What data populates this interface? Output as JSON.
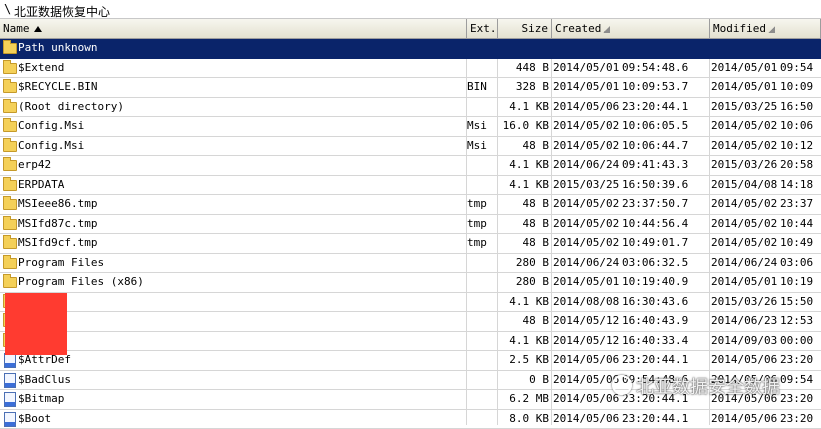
{
  "path_bar": {
    "text": "北亚数据恢复中心"
  },
  "columns": {
    "name": "Name",
    "ext": "Ext.",
    "size": "Size",
    "created": "Created",
    "modified": "Modified"
  },
  "rows": [
    {
      "name": "Path unknown",
      "ext": "",
      "size": "",
      "cdate": "",
      "ctime": "",
      "mdate": "",
      "mtime": "",
      "icon": "folder-icon",
      "selected": true
    },
    {
      "name": "$Extend",
      "ext": "",
      "size": "448 B",
      "cdate": "2014/05/01",
      "ctime": "09:54:48.6",
      "mdate": "2014/05/01",
      "mtime": "09:54",
      "icon": "folder-icon"
    },
    {
      "name": "$RECYCLE.BIN",
      "ext": "BIN",
      "size": "328 B",
      "cdate": "2014/05/01",
      "ctime": "10:09:53.7",
      "mdate": "2014/05/01",
      "mtime": "10:09",
      "icon": "folder-icon"
    },
    {
      "name": "(Root directory)",
      "ext": "",
      "size": "4.1 KB",
      "cdate": "2014/05/06",
      "ctime": "23:20:44.1",
      "mdate": "2015/03/25",
      "mtime": "16:50",
      "icon": "folder-icon"
    },
    {
      "name": "Config.Msi",
      "ext": "Msi",
      "size": "16.0 KB",
      "cdate": "2014/05/02",
      "ctime": "10:06:05.5",
      "mdate": "2014/05/02",
      "mtime": "10:06",
      "icon": "folder-icon"
    },
    {
      "name": "Config.Msi",
      "ext": "Msi",
      "size": "48 B",
      "cdate": "2014/05/02",
      "ctime": "10:06:44.7",
      "mdate": "2014/05/02",
      "mtime": "10:12",
      "icon": "folder-icon"
    },
    {
      "name": "erp42",
      "ext": "",
      "size": "4.1 KB",
      "cdate": "2014/06/24",
      "ctime": "09:41:43.3",
      "mdate": "2015/03/26",
      "mtime": "20:58",
      "icon": "folder-icon"
    },
    {
      "name": "ERPDATA",
      "ext": "",
      "size": "4.1 KB",
      "cdate": "2015/03/25",
      "ctime": "16:50:39.6",
      "mdate": "2015/04/08",
      "mtime": "14:18",
      "icon": "folder-icon"
    },
    {
      "name": "MSIeee86.tmp",
      "ext": "tmp",
      "size": "48 B",
      "cdate": "2014/05/02",
      "ctime": "23:37:50.7",
      "mdate": "2014/05/02",
      "mtime": "23:37",
      "icon": "folder-icon"
    },
    {
      "name": "MSIfd87c.tmp",
      "ext": "tmp",
      "size": "48 B",
      "cdate": "2014/05/02",
      "ctime": "10:44:56.4",
      "mdate": "2014/05/02",
      "mtime": "10:44",
      "icon": "folder-icon"
    },
    {
      "name": "MSIfd9cf.tmp",
      "ext": "tmp",
      "size": "48 B",
      "cdate": "2014/05/02",
      "ctime": "10:49:01.7",
      "mdate": "2014/05/02",
      "mtime": "10:49",
      "icon": "folder-icon"
    },
    {
      "name": "Program Files",
      "ext": "",
      "size": "280 B",
      "cdate": "2014/06/24",
      "ctime": "03:06:32.5",
      "mdate": "2014/06/24",
      "mtime": "03:06",
      "icon": "folder-icon"
    },
    {
      "name": "Program Files (x86)",
      "ext": "",
      "size": "280 B",
      "cdate": "2014/05/01",
      "ctime": "10:19:40.9",
      "mdate": "2014/05/01",
      "mtime": "10:19",
      "icon": "folder-icon"
    },
    {
      "name": "",
      "ext": "",
      "size": "4.1 KB",
      "cdate": "2014/08/08",
      "ctime": "16:30:43.6",
      "mdate": "2015/03/26",
      "mtime": "15:50",
      "icon": "folder-icon"
    },
    {
      "name": "",
      "ext": "",
      "size": "48 B",
      "cdate": "2014/05/12",
      "ctime": "16:40:43.9",
      "mdate": "2014/06/23",
      "mtime": "12:53",
      "icon": "folder-icon"
    },
    {
      "name": "",
      "ext": "",
      "size": "4.1 KB",
      "cdate": "2014/05/12",
      "ctime": "16:40:33.4",
      "mdate": "2014/09/03",
      "mtime": "00:00",
      "icon": "folder-icon"
    },
    {
      "name": "$AttrDef",
      "ext": "",
      "size": "2.5 KB",
      "cdate": "2014/05/06",
      "ctime": "23:20:44.1",
      "mdate": "2014/05/06",
      "mtime": "23:20",
      "icon": "file-icon"
    },
    {
      "name": "$BadClus",
      "ext": "",
      "size": "0 B",
      "cdate": "2014/05/06",
      "ctime": "09:54:48.6",
      "mdate": "2014/05/06",
      "mtime": "09:54",
      "icon": "file-icon"
    },
    {
      "name": "$Bitmap",
      "ext": "",
      "size": "6.2 MB",
      "cdate": "2014/05/06",
      "ctime": "23:20:44.1",
      "mdate": "2014/05/06",
      "mtime": "23:20",
      "icon": "file-icon"
    },
    {
      "name": "$Boot",
      "ext": "",
      "size": "8.0 KB",
      "cdate": "2014/05/06",
      "ctime": "23:20:44.1",
      "mdate": "2014/05/06",
      "mtime": "23:20",
      "icon": "file-icon"
    }
  ],
  "watermark": {
    "text": "北亚数据安全数据"
  },
  "colors": {
    "selection": "#0a246a",
    "header": "#ece9d8",
    "redaction": "#ff3b30"
  }
}
